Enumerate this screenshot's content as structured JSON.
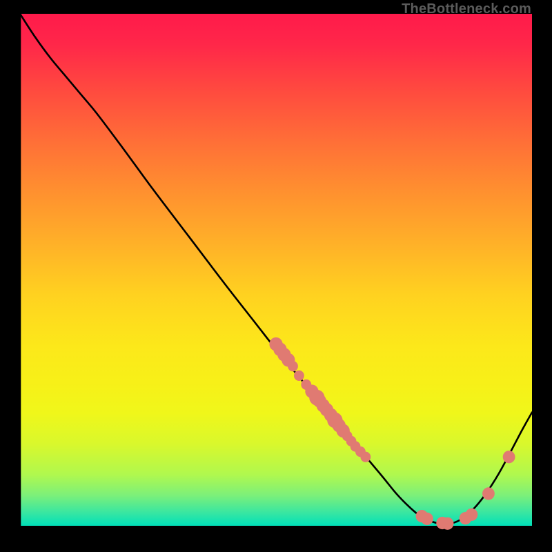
{
  "attribution": "TheBottleneck.com",
  "colors": {
    "background": "#000000",
    "curve_stroke": "#000000",
    "point_fill": "#e07a72",
    "axis_stroke": "#000000",
    "gradient_stops": [
      {
        "offset": 0.0,
        "color": "#ff1a4b"
      },
      {
        "offset": 0.06,
        "color": "#ff2749"
      },
      {
        "offset": 0.15,
        "color": "#ff4a3f"
      },
      {
        "offset": 0.25,
        "color": "#ff6f37"
      },
      {
        "offset": 0.35,
        "color": "#ff912f"
      },
      {
        "offset": 0.45,
        "color": "#ffb128"
      },
      {
        "offset": 0.55,
        "color": "#ffd220"
      },
      {
        "offset": 0.65,
        "color": "#fce81a"
      },
      {
        "offset": 0.72,
        "color": "#f7f018"
      },
      {
        "offset": 0.78,
        "color": "#f0f71a"
      },
      {
        "offset": 0.84,
        "color": "#d9f82c"
      },
      {
        "offset": 0.9,
        "color": "#b0f84e"
      },
      {
        "offset": 0.94,
        "color": "#7df079"
      },
      {
        "offset": 0.975,
        "color": "#37e6a2"
      },
      {
        "offset": 1.0,
        "color": "#00e0b8"
      }
    ]
  },
  "chart_data": {
    "type": "line",
    "title": "",
    "xlabel": "",
    "ylabel": "",
    "xlim": [
      0,
      100
    ],
    "ylim": [
      0,
      100
    ],
    "series": [
      {
        "name": "curve",
        "x": [
          0.0,
          3.0,
          6.0,
          9.0,
          12.0,
          15.0,
          20.0,
          26.0,
          33.0,
          40.0,
          46.0,
          50.0,
          53.0,
          56.0,
          59.0,
          62.0,
          65.0,
          68.0,
          71.0,
          73.5,
          76.0,
          78.5,
          81.0,
          83.5,
          86.0,
          88.5,
          91.0,
          93.5,
          96.0,
          98.0,
          100.0
        ],
        "y": [
          100.0,
          95.5,
          91.5,
          88.0,
          84.5,
          81.0,
          74.5,
          66.5,
          57.5,
          48.5,
          41.0,
          36.0,
          32.5,
          29.0,
          25.5,
          22.0,
          18.5,
          15.0,
          11.5,
          8.5,
          6.0,
          4.0,
          3.0,
          2.7,
          3.5,
          5.5,
          8.5,
          12.3,
          16.8,
          20.5,
          24.0
        ]
      }
    ],
    "scatter_points": {
      "name": "markers",
      "points": [
        {
          "x": 50.0,
          "y": 37.0,
          "r": 1.3
        },
        {
          "x": 50.8,
          "y": 36.0,
          "r": 1.3
        },
        {
          "x": 51.6,
          "y": 35.0,
          "r": 1.3
        },
        {
          "x": 52.4,
          "y": 34.0,
          "r": 1.3
        },
        {
          "x": 53.3,
          "y": 32.8,
          "r": 1.0
        },
        {
          "x": 54.5,
          "y": 31.0,
          "r": 1.0
        },
        {
          "x": 55.9,
          "y": 29.3,
          "r": 1.0
        },
        {
          "x": 57.0,
          "y": 28.0,
          "r": 1.3
        },
        {
          "x": 58.0,
          "y": 26.8,
          "r": 1.5
        },
        {
          "x": 58.5,
          "y": 26.2,
          "r": 1.3
        },
        {
          "x": 59.2,
          "y": 25.3,
          "r": 1.3
        },
        {
          "x": 59.9,
          "y": 24.5,
          "r": 1.3
        },
        {
          "x": 60.7,
          "y": 23.5,
          "r": 1.3
        },
        {
          "x": 61.5,
          "y": 22.5,
          "r": 1.5
        },
        {
          "x": 62.3,
          "y": 21.5,
          "r": 1.3
        },
        {
          "x": 63.1,
          "y": 20.5,
          "r": 1.3
        },
        {
          "x": 63.9,
          "y": 19.5,
          "r": 1.0
        },
        {
          "x": 64.7,
          "y": 18.5,
          "r": 1.0
        },
        {
          "x": 65.5,
          "y": 17.5,
          "r": 1.0
        },
        {
          "x": 66.5,
          "y": 16.5,
          "r": 1.0
        },
        {
          "x": 67.5,
          "y": 15.5,
          "r": 1.0
        },
        {
          "x": 78.5,
          "y": 4.2,
          "r": 1.2
        },
        {
          "x": 79.5,
          "y": 3.7,
          "r": 1.2
        },
        {
          "x": 82.5,
          "y": 2.9,
          "r": 1.2
        },
        {
          "x": 83.5,
          "y": 2.8,
          "r": 1.2
        },
        {
          "x": 87.0,
          "y": 3.8,
          "r": 1.2
        },
        {
          "x": 88.2,
          "y": 4.5,
          "r": 1.2
        },
        {
          "x": 91.5,
          "y": 8.5,
          "r": 1.2
        },
        {
          "x": 95.5,
          "y": 15.5,
          "r": 1.2
        }
      ]
    }
  }
}
